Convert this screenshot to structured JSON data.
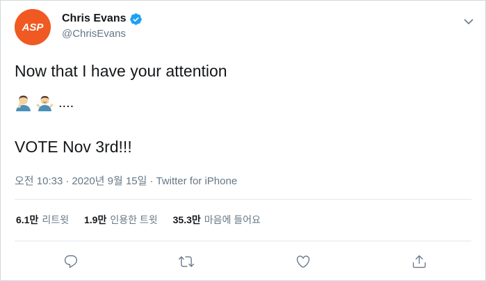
{
  "tweet": {
    "author": {
      "display_name": "Chris Evans",
      "handle": "@ChrisEvans",
      "avatar_text": "ASP",
      "verified": true
    },
    "text_line1": "Now that I have your attention",
    "emoji_names": [
      "facepalm-emoji",
      "shrug-emoji"
    ],
    "text_dots": "....",
    "text_line3": "VOTE Nov 3rd!!!",
    "meta": {
      "time": "오전 10:33",
      "separator": "·",
      "date": "2020년 9월 15일",
      "source": "Twitter for iPhone"
    },
    "stats": [
      {
        "value": "6.1만",
        "label": "리트윗"
      },
      {
        "value": "1.9만",
        "label": "인용한 트윗"
      },
      {
        "value": "35.3만",
        "label": "마음에 들어요"
      }
    ],
    "actions": [
      "reply-icon",
      "retweet-icon",
      "like-icon",
      "share-icon"
    ]
  },
  "colors": {
    "avatar_bg": "#f05a22",
    "verified": "#1da1f2",
    "secondary_text": "#657786",
    "primary_text": "#14171a",
    "divider": "#e1e8ed"
  }
}
